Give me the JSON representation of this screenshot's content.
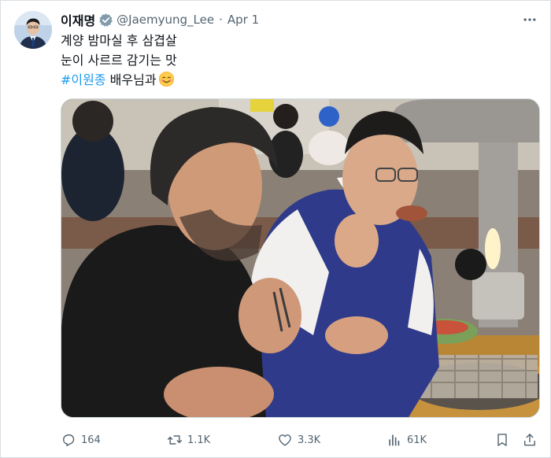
{
  "tweet": {
    "author": {
      "display_name": "이재명",
      "verified_icon": "verified-badge-icon",
      "handle": "@Jaemyung_Lee",
      "separator": "·",
      "date": "Apr 1"
    },
    "more_icon": "more-dots-icon",
    "text": {
      "line1": "계양 밤마실 후 삼겹살",
      "line2": "눈이 사르르 감기는 맛",
      "hashtag": "#이원종",
      "line3_rest": " 배우님과",
      "emoji": "smiling-face-icon"
    },
    "media_icon": "photo",
    "actions": {
      "replies": "164",
      "retweets": "1.1K",
      "likes": "3.3K",
      "views": "61K"
    }
  },
  "colors": {
    "accent": "#1d9bf0",
    "text": "#0f1419",
    "secondary": "#536471",
    "border": "#cfd9de"
  }
}
